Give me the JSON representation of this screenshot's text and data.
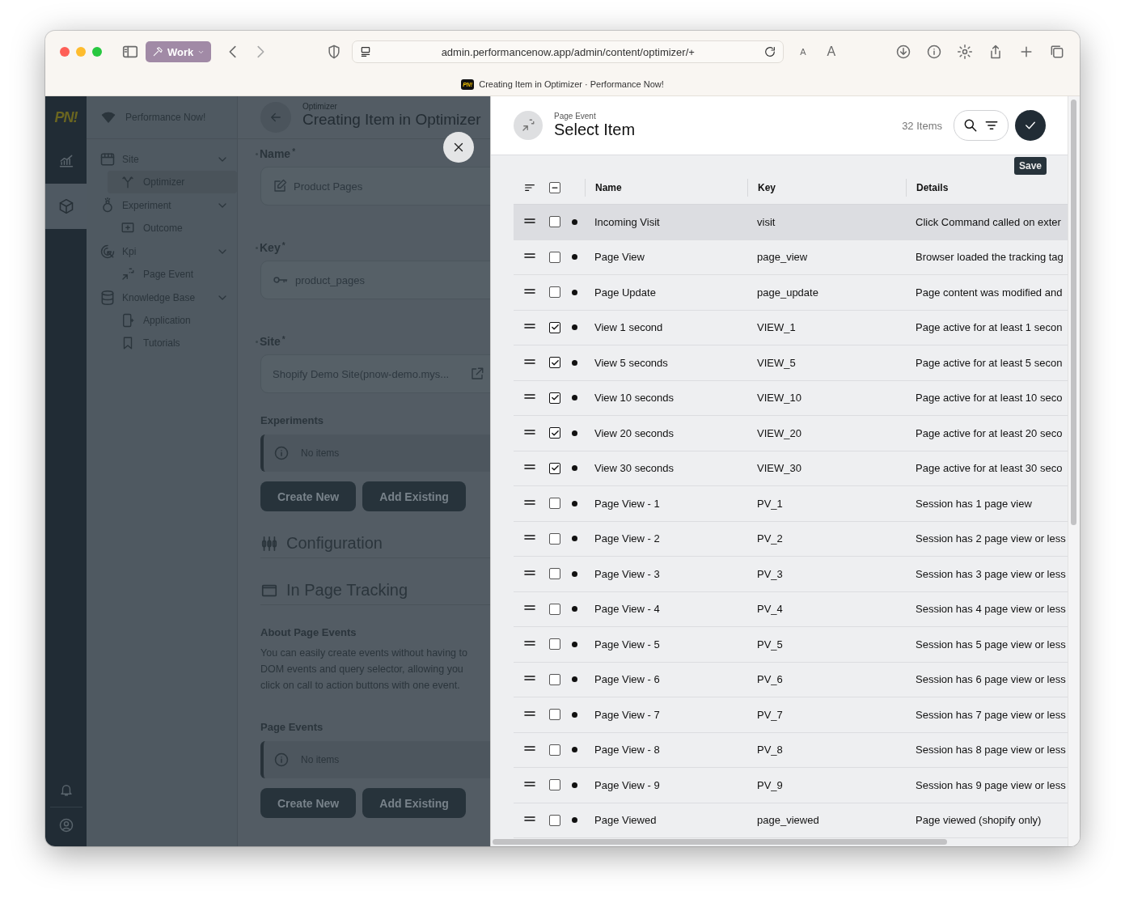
{
  "browser": {
    "profile": "Work",
    "url": "admin.performancenow.app/admin/content/optimizer/+",
    "text_smaller": "A",
    "text_larger": "A",
    "tab_icon": "PN!",
    "tab_title": "Creating Item in Optimizer · Performance Now!"
  },
  "rail": {
    "logo": "PN!",
    "items": [
      {
        "selected": false
      },
      {
        "selected": true
      }
    ]
  },
  "sidebar": {
    "brand": "Performance Now!",
    "items": [
      {
        "label": "Site",
        "expanded": true,
        "children": [
          {
            "label": "Optimizer",
            "selected": true
          }
        ]
      },
      {
        "label": "Experiment",
        "expanded": true,
        "children": [
          {
            "label": "Outcome",
            "selected": false
          }
        ]
      },
      {
        "label": "Kpi",
        "expanded": true,
        "children": [
          {
            "label": "Page Event",
            "selected": false
          }
        ]
      },
      {
        "label": "Knowledge Base",
        "expanded": true,
        "children": [
          {
            "label": "Application",
            "selected": false
          },
          {
            "label": "Tutorials",
            "selected": false
          }
        ]
      }
    ]
  },
  "form": {
    "breadcrumb": "Optimizer",
    "title": "Creating Item in Optimizer",
    "fields": [
      {
        "label": "Name",
        "required": "*",
        "value": "Product Pages",
        "kind": "text"
      },
      {
        "label": "Key",
        "required": "*",
        "value": "product_pages",
        "kind": "key"
      },
      {
        "label": "Site",
        "required": "*",
        "value": "Shopify Demo Site(pnow-demo.mys...",
        "kind": "link"
      }
    ],
    "experiments": {
      "heading": "Experiments",
      "empty": "No items",
      "buttons": [
        "Create New",
        "Add Existing"
      ]
    },
    "configuration": "Configuration",
    "in_page_tracking": "In Page Tracking",
    "about": {
      "heading": "About Page Events",
      "lines": [
        "You can easily create events without having to",
        "DOM events and query selector, allowing you",
        "click on call to action buttons with one event."
      ]
    },
    "page_events": {
      "heading": "Page Events",
      "empty": "No items",
      "buttons": [
        "Create New",
        "Add Existing"
      ]
    }
  },
  "panel": {
    "kind": "Page Event",
    "title": "Select Item",
    "count": "32 Items",
    "save_tooltip": "Save",
    "columns": [
      "Name",
      "Key",
      "Details"
    ],
    "select_all_partial": true,
    "rows": [
      {
        "name": "Incoming Visit",
        "key": "visit",
        "details": "Click Command called on exter",
        "checked": false,
        "selected": true
      },
      {
        "name": "Page View",
        "key": "page_view",
        "details": "Browser loaded the tracking tag",
        "checked": false,
        "selected": false
      },
      {
        "name": "Page Update",
        "key": "page_update",
        "details": "Page content was modified and",
        "checked": false,
        "selected": false
      },
      {
        "name": "View 1 second",
        "key": "VIEW_1",
        "details": "Page active for at least 1 secon",
        "checked": true,
        "selected": false
      },
      {
        "name": "View 5 seconds",
        "key": "VIEW_5",
        "details": "Page active for at least 5 secon",
        "checked": true,
        "selected": false
      },
      {
        "name": "View 10 seconds",
        "key": "VIEW_10",
        "details": "Page active for at least 10 seco",
        "checked": true,
        "selected": false
      },
      {
        "name": "View 20 seconds",
        "key": "VIEW_20",
        "details": "Page active for at least 20 seco",
        "checked": true,
        "selected": false
      },
      {
        "name": "View 30 seconds",
        "key": "VIEW_30",
        "details": "Page active for at least 30 seco",
        "checked": true,
        "selected": false
      },
      {
        "name": "Page View - 1",
        "key": "PV_1",
        "details": "Session has 1 page view",
        "checked": false,
        "selected": false
      },
      {
        "name": "Page View - 2",
        "key": "PV_2",
        "details": "Session has 2 page view or less",
        "checked": false,
        "selected": false
      },
      {
        "name": "Page View - 3",
        "key": "PV_3",
        "details": "Session has 3 page view or less",
        "checked": false,
        "selected": false
      },
      {
        "name": "Page View - 4",
        "key": "PV_4",
        "details": "Session has 4 page view or less",
        "checked": false,
        "selected": false
      },
      {
        "name": "Page View - 5",
        "key": "PV_5",
        "details": "Session has 5 page view or less",
        "checked": false,
        "selected": false
      },
      {
        "name": "Page View - 6",
        "key": "PV_6",
        "details": "Session has 6 page view or less",
        "checked": false,
        "selected": false
      },
      {
        "name": "Page View - 7",
        "key": "PV_7",
        "details": "Session has 7 page view or less",
        "checked": false,
        "selected": false
      },
      {
        "name": "Page View - 8",
        "key": "PV_8",
        "details": "Session has 8 page view or less",
        "checked": false,
        "selected": false
      },
      {
        "name": "Page View - 9",
        "key": "PV_9",
        "details": "Session has 9 page view or less",
        "checked": false,
        "selected": false
      },
      {
        "name": "Page Viewed",
        "key": "page_viewed",
        "details": "Page viewed (shopify only)",
        "checked": false,
        "selected": false
      }
    ]
  }
}
